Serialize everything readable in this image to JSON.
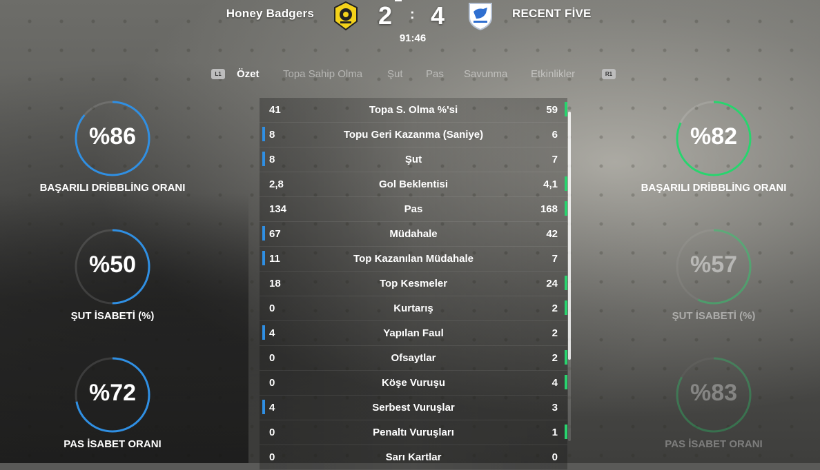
{
  "match": {
    "home_team": "Honey Badgers",
    "away_team": "RECENT FİVE",
    "home_score": "2",
    "away_score": "4",
    "score_separator": ":",
    "clock": "91:46",
    "home_badge_icon": "honey-badger-crest-icon",
    "away_badge_icon": "recent-five-crest-icon"
  },
  "tabs": {
    "left_hint": "L1",
    "right_hint": "R1",
    "items": [
      "Özet",
      "Topa Sahip Olma",
      "Şut",
      "Pas",
      "Savunma",
      "Etkinlikler"
    ],
    "active": "Özet"
  },
  "colors": {
    "home_accent": "#2f8fe3",
    "away_accent": "#28d46e"
  },
  "stats": [
    {
      "label": "Topa S. Olma %'si",
      "home": "41",
      "away": "59",
      "leader": "away"
    },
    {
      "label": "Topu Geri Kazanma (Saniye)",
      "home": "8",
      "away": "6",
      "leader": "home"
    },
    {
      "label": "Şut",
      "home": "8",
      "away": "7",
      "leader": "home"
    },
    {
      "label": "Gol Beklentisi",
      "home": "2,8",
      "away": "4,1",
      "leader": "away"
    },
    {
      "label": "Pas",
      "home": "134",
      "away": "168",
      "leader": "away"
    },
    {
      "label": "Müdahale",
      "home": "67",
      "away": "42",
      "leader": "home"
    },
    {
      "label": "Top Kazanılan Müdahale",
      "home": "11",
      "away": "7",
      "leader": "home"
    },
    {
      "label": "Top Kesmeler",
      "home": "18",
      "away": "24",
      "leader": "away"
    },
    {
      "label": "Kurtarış",
      "home": "0",
      "away": "2",
      "leader": "away"
    },
    {
      "label": "Yapılan Faul",
      "home": "4",
      "away": "2",
      "leader": "home"
    },
    {
      "label": "Ofsaytlar",
      "home": "0",
      "away": "2",
      "leader": "away"
    },
    {
      "label": "Köşe Vuruşu",
      "home": "0",
      "away": "4",
      "leader": "away"
    },
    {
      "label": "Serbest Vuruşlar",
      "home": "4",
      "away": "3",
      "leader": "home"
    },
    {
      "label": "Penaltı Vuruşları",
      "home": "0",
      "away": "1",
      "leader": "away"
    },
    {
      "label": "Sarı Kartlar",
      "home": "0",
      "away": "0",
      "leader": "none"
    }
  ],
  "home_rings": [
    {
      "text": "%86",
      "value": 86,
      "label": "BAŞARILI DRİBBLİNG ORANI"
    },
    {
      "text": "%50",
      "value": 50,
      "label": "ŞUT İSABETİ (%)"
    },
    {
      "text": "%72",
      "value": 72,
      "label": "PAS İSABET ORANI"
    }
  ],
  "away_rings": [
    {
      "text": "%82",
      "value": 82,
      "label": "BAŞARILI DRİBBLİNG ORANI"
    },
    {
      "text": "%57",
      "value": 57,
      "label": "ŞUT İSABETİ (%)"
    },
    {
      "text": "%83",
      "value": 83,
      "label": "PAS İSABET ORANI"
    }
  ],
  "scroll_position": 0.0
}
